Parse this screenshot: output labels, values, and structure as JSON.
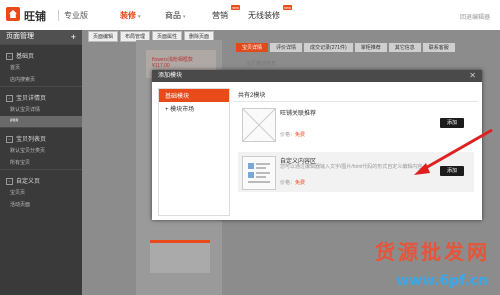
{
  "header": {
    "brand": "旺铺",
    "edition": "专业版",
    "nav": [
      {
        "label": "装修",
        "active": true,
        "caret": "▾",
        "badge": ""
      },
      {
        "label": "商品",
        "active": false,
        "caret": "▾",
        "badge": ""
      },
      {
        "label": "营销",
        "active": false,
        "caret": "",
        "badge": "new"
      },
      {
        "label": "无线装修",
        "active": false,
        "caret": "",
        "badge": "new"
      }
    ],
    "user": "回退编辑器"
  },
  "sidebar": {
    "title": "页面管理",
    "plus": "+",
    "groups": [
      {
        "label": "基础页",
        "items": [
          {
            "label": "首页",
            "selected": false
          },
          {
            "label": "店内搜索页",
            "selected": false
          }
        ]
      },
      {
        "label": "宝贝详情页",
        "items": [
          {
            "label": "默认宝贝详情",
            "selected": false
          },
          {
            "label": "###",
            "selected": true
          }
        ]
      },
      {
        "label": "宝贝列表页",
        "items": [
          {
            "label": "默认宝贝分类页",
            "selected": false
          },
          {
            "label": "所有宝贝",
            "selected": false
          }
        ]
      },
      {
        "label": "自定义页",
        "items": [
          {
            "label": "宝贝页",
            "selected": false
          },
          {
            "label": "活动页面",
            "selected": false
          }
        ]
      }
    ]
  },
  "toolbar": {
    "tabs": [
      "页面编辑",
      "布局管理",
      "页面属性",
      "删除页面"
    ]
  },
  "preview": {
    "red_text": "flowers浅粉相框款",
    "red_price": "¥117.00"
  },
  "right_tabs": [
    {
      "label": "宝贝详情",
      "active": true
    },
    {
      "label": "评价详情",
      "active": false
    },
    {
      "label": "成交记录(271件)",
      "active": false
    },
    {
      "label": "掌柜推荐",
      "active": false
    },
    {
      "label": "其它信息",
      "active": false
    },
    {
      "label": "联系客服",
      "active": false
    }
  ],
  "ghost_text": "宝贝描述信息",
  "dialog": {
    "title": "添加模块",
    "close": "✕",
    "left_items": [
      {
        "label": "基础模块",
        "selected": true
      },
      {
        "label": "+ 模块市场",
        "selected": false
      }
    ],
    "right_title": "共有2模块",
    "modules": [
      {
        "name": "旺铺关联推荐",
        "desc": "",
        "price_label": "价格：",
        "price": "免费",
        "add": "添加"
      },
      {
        "name": "自定义内容区",
        "desc": "您可以通过编辑器输入文字/图片/html代码的形式自定义编辑内容。",
        "price_label": "价格：",
        "price": "免费",
        "add": "添加"
      }
    ]
  },
  "watermark": {
    "text": "货源批发网",
    "url": "www.6pf.cn"
  },
  "colors": {
    "accent": "#e84a1a",
    "sidebar_bg": "#3a3a3a",
    "dialog_title": "#4a4a4a",
    "watermark_url": "#3aa8e6"
  }
}
